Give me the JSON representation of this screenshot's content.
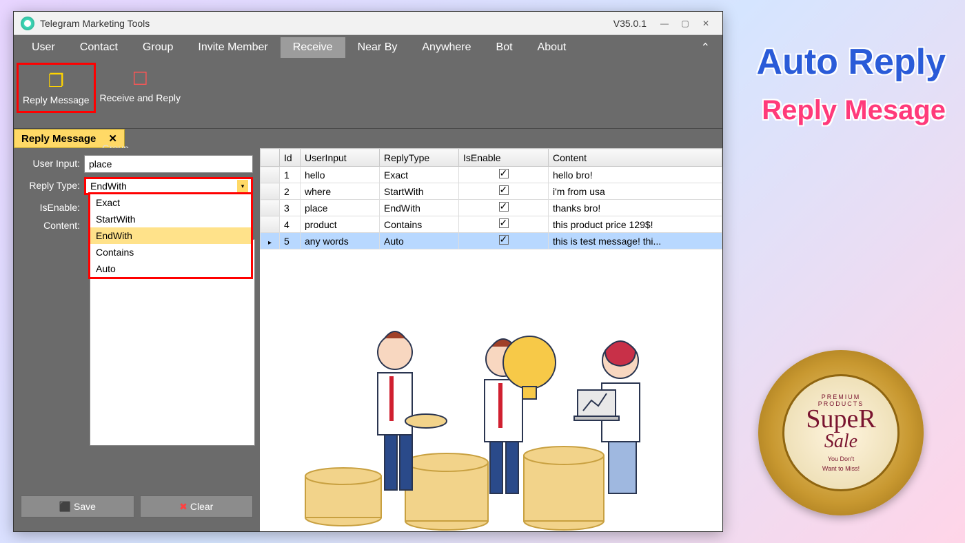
{
  "window": {
    "title": "Telegram Marketing Tools",
    "version": "V35.0.1"
  },
  "menu": [
    "User",
    "Contact",
    "Group",
    "Invite Member",
    "Receive",
    "Near By",
    "Anywhere",
    "Bot",
    "About"
  ],
  "menu_active": "Receive",
  "ribbon": {
    "reply": "Reply Message",
    "receive": "Receive and Reply",
    "group_label": "Group"
  },
  "tab": {
    "title": "Reply Message",
    "close": "✕"
  },
  "form": {
    "labels": {
      "user_input": "User Input:",
      "reply_type": "Reply Type:",
      "is_enable": "IsEnable:",
      "content": "Content:"
    },
    "user_input_value": "place",
    "reply_type_value": "EndWith",
    "options": [
      "Exact",
      "StartWith",
      "EndWith",
      "Contains",
      "Auto"
    ],
    "selected_option": "EndWith"
  },
  "buttons": {
    "save": "Save",
    "clear": "Clear"
  },
  "grid": {
    "headers": [
      "Id",
      "UserInput",
      "ReplyType",
      "IsEnable",
      "Content"
    ],
    "rows": [
      {
        "id": "1",
        "user_input": "hello",
        "reply_type": "Exact",
        "is_enable": true,
        "content": "hello bro!"
      },
      {
        "id": "2",
        "user_input": "where",
        "reply_type": "StartWith",
        "is_enable": true,
        "content": "i'm from usa"
      },
      {
        "id": "3",
        "user_input": "place",
        "reply_type": "EndWith",
        "is_enable": true,
        "content": "thanks bro!"
      },
      {
        "id": "4",
        "user_input": "product",
        "reply_type": "Contains",
        "is_enable": true,
        "content": "this product price 129$!"
      },
      {
        "id": "5",
        "user_input": "any words",
        "reply_type": "Auto",
        "is_enable": true,
        "content": "this is test message! thi..."
      }
    ],
    "selected_row": 4
  },
  "promo": {
    "title": "Auto Reply",
    "subtitle": "Reply Mesage",
    "seal": {
      "premium": "PREMIUM",
      "products": "PRODUCTS",
      "super": "SupeR",
      "sale": "Sale",
      "tag1": "You Don't",
      "tag2": "Want to Miss!"
    }
  }
}
